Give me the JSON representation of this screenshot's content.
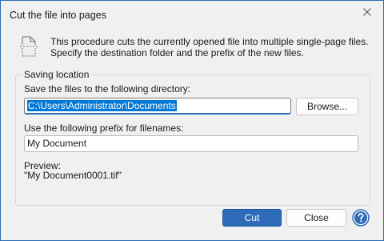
{
  "window": {
    "title": "Cut the file into pages"
  },
  "intro": {
    "text": "This procedure cuts the currently opened file into multiple single-page files. Specify the destination folder and the prefix of the new files."
  },
  "saving_location": {
    "legend": "Saving location",
    "directory_label": "Save the files to the following directory:",
    "directory_value": "C:\\Users\\Administrator\\Documents",
    "browse_label": "Browse...",
    "prefix_label": "Use the following prefix for filenames:",
    "prefix_value": "My Document",
    "preview_label": "Preview:",
    "preview_value": "\"My Document0001.tif\""
  },
  "buttons": {
    "cut": "Cut",
    "close": "Close"
  },
  "colors": {
    "accent": "#2e6bb8",
    "selection": "#0078d7",
    "window_border": "#2b6cb3"
  },
  "icons": {
    "document": "document-split-icon",
    "close": "close-icon",
    "help": "help-icon"
  }
}
